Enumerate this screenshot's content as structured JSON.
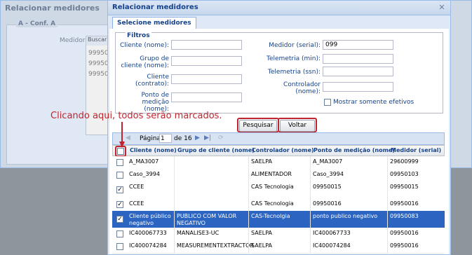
{
  "background": {
    "window_title": "Relacionar medidores",
    "section_legend": "A - Conf. A",
    "medidor_label": "Medidor:",
    "buscar_label": "Buscar",
    "values": [
      "99950",
      "99950",
      "99950"
    ]
  },
  "dialog": {
    "title": "Relacionar medidores",
    "tab": "Selecione medidores",
    "filters": {
      "legend": "Filtros",
      "cliente_nome": "Cliente (nome):",
      "grupo_cliente": "Grupo de cliente (nome):",
      "cliente_contrato": "Cliente (contrato):",
      "ponto_medicao": "Ponto de medição (nome):",
      "medidor_serial": "Medidor (serial):",
      "medidor_serial_value": "099",
      "telemetria_min": "Telemetria (min):",
      "telemetria_ssn": "Telemetria (ssn):",
      "controlador_nome": "Controlador (nome):",
      "mostrar_efetivos": "Mostrar somente efetivos"
    },
    "buttons": {
      "pesquisar": "Pesquisar",
      "voltar": "Voltar"
    },
    "pager": {
      "page_label": "Página",
      "page_value": "1",
      "of_label": "de 16"
    },
    "grid": {
      "columns": [
        "Cliente (nome)",
        "Grupo de cliente (nome)",
        "Controlador (nome)",
        "Ponto de medição (nome)",
        "Medidor (serial)"
      ],
      "rows": [
        {
          "cliente": "A_MA3007",
          "grupo": "",
          "controlador": "SAELPA",
          "ponto": "A_MA3007",
          "medidor": "29600999",
          "checked": false,
          "selected": false
        },
        {
          "cliente": "Caso_3994",
          "grupo": "",
          "controlador": "ALIMENTADOR",
          "ponto": "Caso_3994",
          "medidor": "09950103",
          "checked": false,
          "selected": false
        },
        {
          "cliente": "CCEE",
          "grupo": "",
          "controlador": "CAS Tecnologia",
          "ponto": "09950015",
          "medidor": "09950015",
          "checked": true,
          "selected": false
        },
        {
          "cliente": "CCEE",
          "grupo": "",
          "controlador": "CAS Tecnologia",
          "ponto": "09950016",
          "medidor": "09950016",
          "checked": true,
          "selected": false
        },
        {
          "cliente": "Cliente público negativo",
          "grupo": "PUBLICO COM VALOR NEGATIVO",
          "controlador": "CAS-Tecnolgia",
          "ponto": "ponto publico negativo",
          "medidor": "09950083",
          "checked": true,
          "selected": true
        },
        {
          "cliente": "IC400067733",
          "grupo": "MANALISE3-UC",
          "controlador": "SAELPA",
          "ponto": "IC400067733",
          "medidor": "09950016",
          "checked": false,
          "selected": false
        },
        {
          "cliente": "IC400074284",
          "grupo": "MEASUREMENTEXTRACTOR",
          "controlador": "SAELPA",
          "ponto": "IC400074284",
          "medidor": "09950016",
          "checked": false,
          "selected": false
        }
      ]
    }
  },
  "annotation": "Clicando aqui, todos serão marcados.",
  "colors": {
    "accent": "#c0242e",
    "selection": "#2b65c1"
  }
}
